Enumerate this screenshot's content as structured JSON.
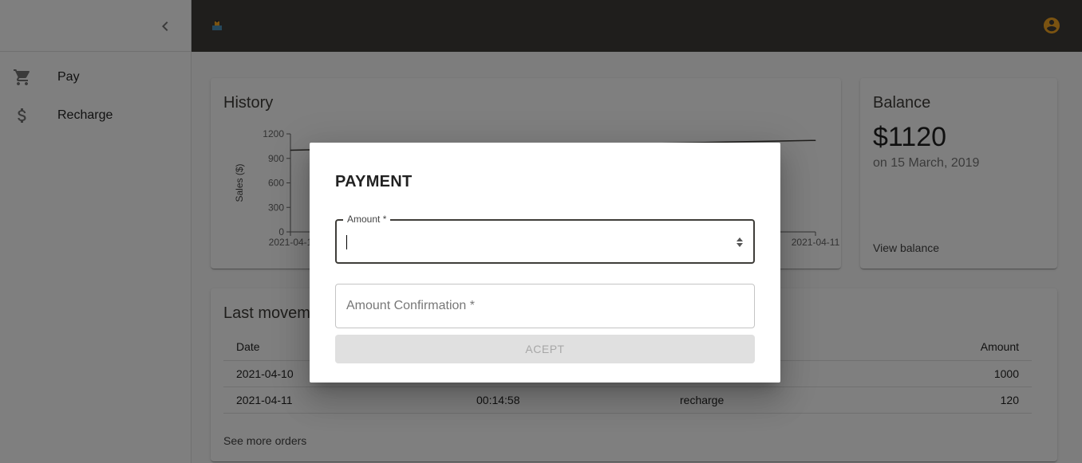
{
  "drawer": {
    "collapse_icon": "chevron-left-icon",
    "items": [
      {
        "label": "Pay",
        "icon": "cart-icon"
      },
      {
        "label": "Recharge",
        "icon": "dollar-icon"
      }
    ]
  },
  "appbar": {
    "logo_icon": "logo-icon",
    "account_icon": "account-circle-icon",
    "accent": "#f5a623"
  },
  "history": {
    "title": "History",
    "chart_data": {
      "type": "line",
      "x": [
        "2021-04-10",
        "2021-04-11"
      ],
      "series": [
        {
          "values": [
            1000,
            1120
          ]
        }
      ],
      "ylabel": "Sales ($)",
      "yticks": [
        "1200",
        "900",
        "600",
        "300",
        "0"
      ],
      "xtick_labels": [
        "2021-04-1",
        "2021-04-11"
      ],
      "ylim": [
        0,
        1200
      ]
    }
  },
  "balance": {
    "title": "Balance",
    "amount": "$1120",
    "date": "on 15 March, 2019",
    "link": "View balance"
  },
  "movements": {
    "title": "Last moveme",
    "columns": [
      "Date",
      "",
      "",
      "Amount"
    ],
    "rows": [
      {
        "date": "2021-04-10",
        "time": "",
        "type": "",
        "amount": "1000"
      },
      {
        "date": "2021-04-11",
        "time": "00:14:58",
        "type": "recharge",
        "amount": "120"
      }
    ],
    "link": "See more orders"
  },
  "modal": {
    "title": "PAYMENT",
    "amount_label": "Amount *",
    "amount_value": "",
    "confirmation_placeholder": "Amount Confirmation *",
    "accept_label": "ACEPT"
  }
}
